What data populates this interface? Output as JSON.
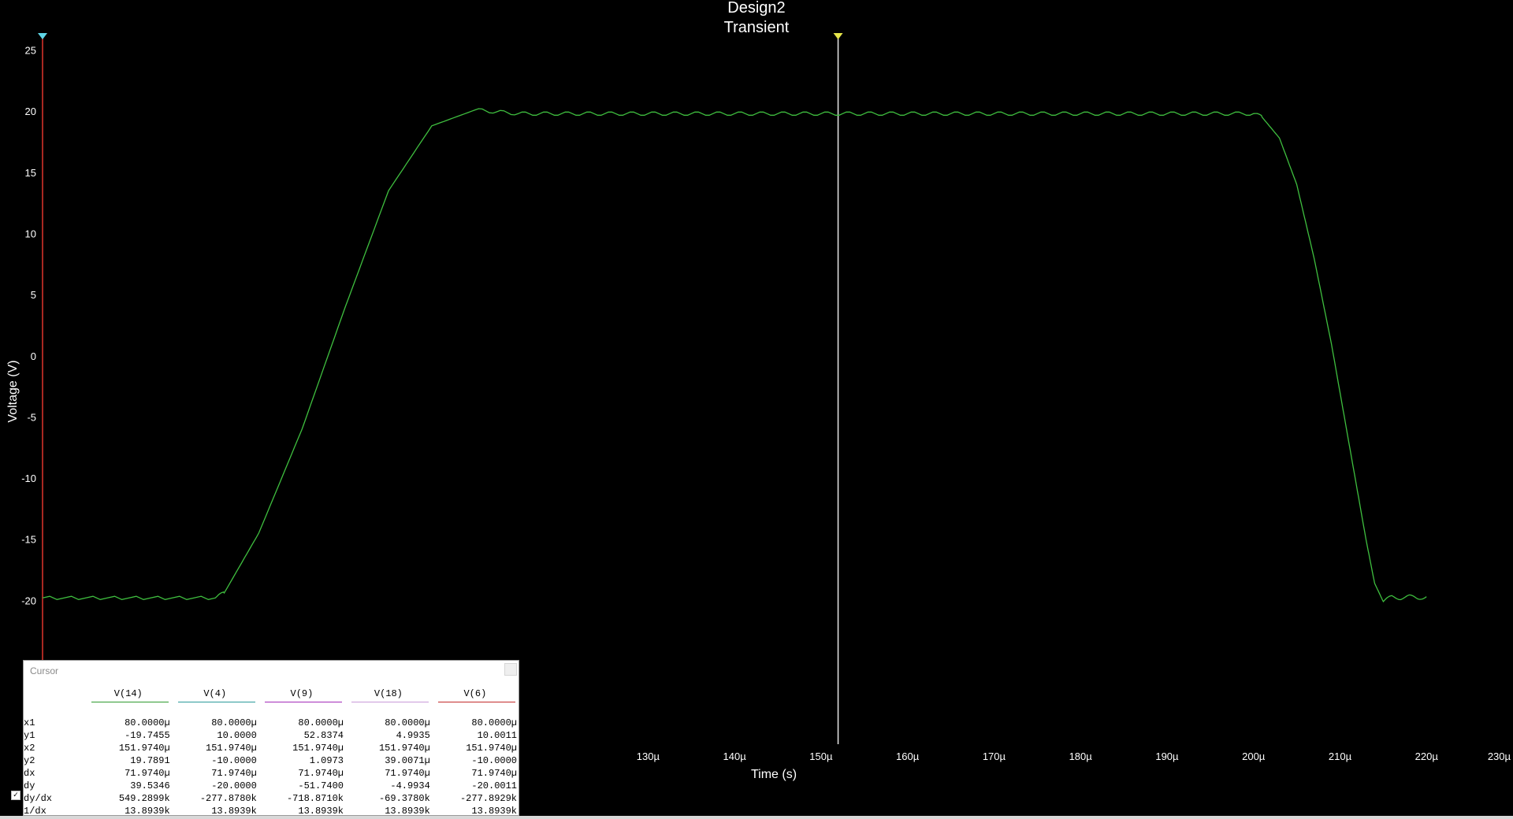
{
  "chart_data": {
    "type": "line",
    "title": [
      "Design2",
      "Transient"
    ],
    "xlabel": "Time (s)",
    "ylabel": "Voltage (V)",
    "xlim": [
      60,
      230
    ],
    "ylim": [
      -25,
      26
    ],
    "x_ticks": [
      130,
      140,
      150,
      160,
      170,
      180,
      190,
      200,
      210,
      220,
      230
    ],
    "x_tick_labels": [
      "130µ",
      "140µ",
      "150µ",
      "160µ",
      "170µ",
      "180µ",
      "190µ",
      "200µ",
      "210µ",
      "220µ",
      "230µ"
    ],
    "y_ticks": [
      25,
      20,
      15,
      10,
      5,
      0,
      -5,
      -10,
      -15,
      -20
    ],
    "y_tick_labels": [
      "25",
      "20",
      "15",
      "10",
      "5",
      "0",
      "-5",
      "-10",
      "-15",
      "-20"
    ],
    "grid": false,
    "series": [
      {
        "color": "#3fbf3f",
        "x": [
          60,
          70,
          80,
          81,
          85,
          90,
          95,
          100,
          105,
          110,
          115,
          120,
          125,
          130,
          135,
          140,
          145,
          150,
          155,
          160,
          165,
          170,
          175,
          180,
          185,
          190,
          195,
          200,
          201,
          203,
          205,
          207,
          209,
          211,
          213,
          214,
          215,
          216,
          217,
          218,
          219,
          220
        ],
        "y": [
          -19.8,
          -19.8,
          -19.8,
          -19.4,
          -14.5,
          -6,
          4,
          13.5,
          18.8,
          20.1,
          19.8,
          19.8,
          19.8,
          19.8,
          19.8,
          19.8,
          19.8,
          19.8,
          19.8,
          19.8,
          19.8,
          19.8,
          19.8,
          19.8,
          19.8,
          19.8,
          19.8,
          19.8,
          19.5,
          17.8,
          14,
          8,
          1,
          -7,
          -15,
          -18.6,
          -20.1,
          -19.7,
          -19.8,
          -19.7,
          -19.8,
          -19.7
        ]
      }
    ]
  },
  "cursors": {
    "cursor1_x": 60,
    "cursor2_x": 151.974,
    "cursor1_color": "#e0342c",
    "cursor2_color": "#e8e8e8"
  },
  "cursor_panel": {
    "title": "Cursor",
    "columns": [
      {
        "label": "V(14)",
        "color": "#2e9a2e"
      },
      {
        "label": "V(4)",
        "color": "#2a9a9a"
      },
      {
        "label": "V(9)",
        "color": "#a22ab8"
      },
      {
        "label": "V(18)",
        "color": "#c89ad8"
      },
      {
        "label": "V(6)",
        "color": "#c22a2a"
      }
    ],
    "rows": [
      {
        "label": "x1",
        "values": [
          "80.0000µ",
          "80.0000µ",
          "80.0000µ",
          "80.0000µ",
          "80.0000µ"
        ]
      },
      {
        "label": "y1",
        "values": [
          "-19.7455",
          "10.0000",
          "52.8374",
          "4.9935",
          "10.0011"
        ]
      },
      {
        "label": "x2",
        "values": [
          "151.9740µ",
          "151.9740µ",
          "151.9740µ",
          "151.9740µ",
          "151.9740µ"
        ]
      },
      {
        "label": "y2",
        "values": [
          "19.7891",
          "-10.0000",
          "1.0973",
          "39.0071µ",
          "-10.0000"
        ]
      },
      {
        "label": "dx",
        "values": [
          "71.9740µ",
          "71.9740µ",
          "71.9740µ",
          "71.9740µ",
          "71.9740µ"
        ]
      },
      {
        "label": "dy",
        "values": [
          "39.5346",
          "-20.0000",
          "-51.7400",
          "-4.9934",
          "-20.0011"
        ]
      },
      {
        "label": "dy/dx",
        "values": [
          "549.2899k",
          "-277.8780k",
          "-718.8710k",
          "-69.3780k",
          "-277.8929k"
        ]
      },
      {
        "label": "1/dx",
        "values": [
          "13.8939k",
          "13.8939k",
          "13.8939k",
          "13.8939k",
          "13.8939k"
        ]
      }
    ]
  }
}
